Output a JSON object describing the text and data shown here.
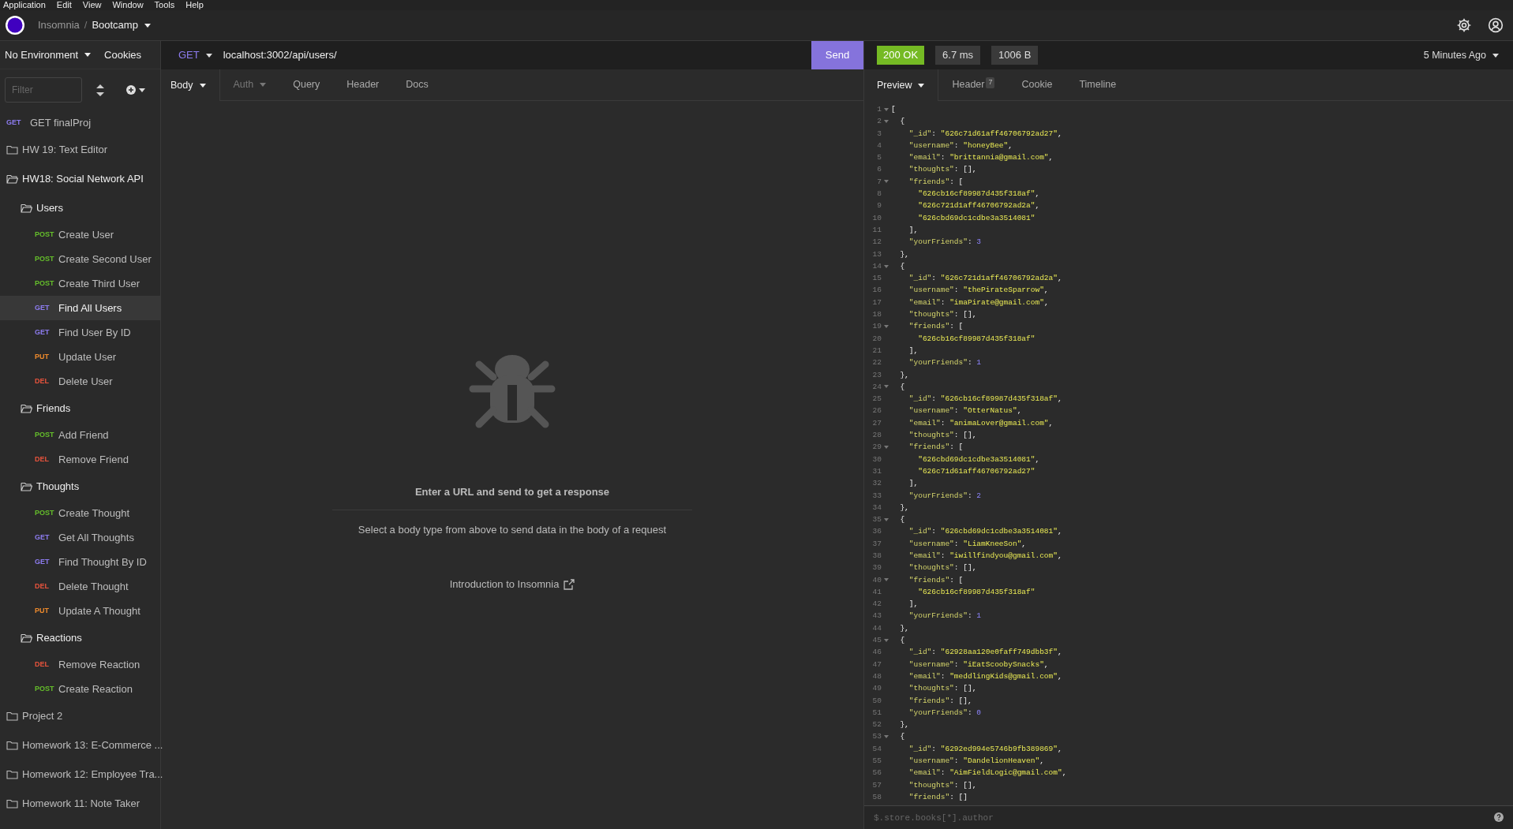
{
  "menu_bar": [
    "Application",
    "Edit",
    "View",
    "Window",
    "Tools",
    "Help"
  ],
  "header": {
    "app": "Insomnia",
    "separator": "/",
    "workspace": "Bootcamp"
  },
  "environment": {
    "label": "No Environment",
    "cookies": "Cookies"
  },
  "filter": {
    "placeholder": "Filter"
  },
  "sidebar": {
    "items": [
      {
        "kind": "request",
        "method": "GET",
        "color": "#8d7cf0",
        "label": "GET finalProj",
        "selected": false
      },
      {
        "kind": "folder",
        "label": "HW 19: Text Editor",
        "expanded": false
      },
      {
        "kind": "folder",
        "label": "HW18: Social Network API",
        "expanded": true,
        "children": [
          {
            "kind": "folder",
            "label": "Users",
            "expanded": true,
            "children": [
              {
                "kind": "request",
                "method": "POST",
                "color": "#65bf2b",
                "label": "Create User",
                "selected": false
              },
              {
                "kind": "request",
                "method": "POST",
                "color": "#65bf2b",
                "label": "Create Second User",
                "selected": false
              },
              {
                "kind": "request",
                "method": "POST",
                "color": "#65bf2b",
                "label": "Create Third User",
                "selected": false
              },
              {
                "kind": "request",
                "method": "GET",
                "color": "#8d7cf0",
                "label": "Find All Users",
                "selected": true
              },
              {
                "kind": "request",
                "method": "GET",
                "color": "#8d7cf0",
                "label": "Find User By ID",
                "selected": false
              },
              {
                "kind": "request",
                "method": "PUT",
                "color": "#ee8a2c",
                "label": "Update User",
                "selected": false
              },
              {
                "kind": "request",
                "method": "DEL",
                "color": "#e8533c",
                "label": "Delete User",
                "selected": false
              }
            ]
          },
          {
            "kind": "folder",
            "label": "Friends",
            "expanded": true,
            "children": [
              {
                "kind": "request",
                "method": "POST",
                "color": "#65bf2b",
                "label": "Add Friend",
                "selected": false
              },
              {
                "kind": "request",
                "method": "DEL",
                "color": "#e8533c",
                "label": "Remove Friend",
                "selected": false
              }
            ]
          },
          {
            "kind": "folder",
            "label": "Thoughts",
            "expanded": true,
            "children": [
              {
                "kind": "request",
                "method": "POST",
                "color": "#65bf2b",
                "label": "Create Thought",
                "selected": false
              },
              {
                "kind": "request",
                "method": "GET",
                "color": "#8d7cf0",
                "label": "Get All Thoughts",
                "selected": false
              },
              {
                "kind": "request",
                "method": "GET",
                "color": "#8d7cf0",
                "label": "Find Thought By ID",
                "selected": false
              },
              {
                "kind": "request",
                "method": "DEL",
                "color": "#e8533c",
                "label": "Delete Thought",
                "selected": false
              },
              {
                "kind": "request",
                "method": "PUT",
                "color": "#ee8a2c",
                "label": "Update A Thought",
                "selected": false
              }
            ]
          },
          {
            "kind": "folder",
            "label": "Reactions",
            "expanded": true,
            "children": [
              {
                "kind": "request",
                "method": "DEL",
                "color": "#e8533c",
                "label": "Remove Reaction",
                "selected": false
              },
              {
                "kind": "request",
                "method": "POST",
                "color": "#65bf2b",
                "label": "Create Reaction",
                "selected": false
              }
            ]
          }
        ]
      },
      {
        "kind": "folder",
        "label": "Project 2",
        "expanded": false
      },
      {
        "kind": "folder",
        "label": "Homework 13: E-Commerce ...",
        "expanded": false
      },
      {
        "kind": "folder",
        "label": "Homework 12: Employee Tra...",
        "expanded": false
      },
      {
        "kind": "folder",
        "label": "Homework 11: Note Taker",
        "expanded": false
      }
    ]
  },
  "request": {
    "method": "GET",
    "url": "localhost:3002/api/users/",
    "send": "Send",
    "tabs": [
      {
        "label": "Body",
        "dropdown": true,
        "selected": true,
        "disabled": false
      },
      {
        "label": "Auth",
        "dropdown": true,
        "selected": false,
        "disabled": true
      },
      {
        "label": "Query",
        "dropdown": false,
        "selected": false,
        "disabled": false
      },
      {
        "label": "Header",
        "dropdown": false,
        "selected": false,
        "disabled": false
      },
      {
        "label": "Docs",
        "dropdown": false,
        "selected": false,
        "disabled": false
      }
    ]
  },
  "empty_state": {
    "title": "Enter a URL and send to get a response",
    "hint": "Select a body type from above to send data in the body of a request",
    "link": "Introduction to Insomnia"
  },
  "response": {
    "status": "200 OK",
    "time": "6.7 ms",
    "size": "1006 B",
    "age": "5 Minutes Ago",
    "tabs": [
      {
        "label": "Preview",
        "dropdown": true,
        "selected": true
      },
      {
        "label": "Header",
        "dropdown": false,
        "badge": "7",
        "selected": false
      },
      {
        "label": "Cookie",
        "dropdown": false,
        "selected": false
      },
      {
        "label": "Timeline",
        "dropdown": false,
        "selected": false
      }
    ],
    "lines": [
      {
        "number": "1",
        "code": "[",
        "foldable": true
      },
      {
        "number": "2",
        "code": "  {",
        "foldable": true
      },
      {
        "number": "3",
        "code": "    \"_id\": \"626c71d61aff46706792ad27\",",
        "foldable": false
      },
      {
        "number": "4",
        "code": "    \"username\": \"honeyBee\",",
        "foldable": false
      },
      {
        "number": "5",
        "code": "    \"email\": \"brittannia@gmail.com\",",
        "foldable": false
      },
      {
        "number": "6",
        "code": "    \"thoughts\": [],",
        "foldable": false
      },
      {
        "number": "7",
        "code": "    \"friends\": [",
        "foldable": true
      },
      {
        "number": "8",
        "code": "      \"626cb16cf89987d435f318af\",",
        "foldable": false
      },
      {
        "number": "9",
        "code": "      \"626c721d1aff46706792ad2a\",",
        "foldable": false
      },
      {
        "number": "10",
        "code": "      \"626cbd69dc1cdbe3a3514081\"",
        "foldable": false
      },
      {
        "number": "11",
        "code": "    ],",
        "foldable": false
      },
      {
        "number": "12",
        "code": "    \"yourFriends\": 3",
        "foldable": false
      },
      {
        "number": "13",
        "code": "  },",
        "foldable": false
      },
      {
        "number": "14",
        "code": "  {",
        "foldable": true
      },
      {
        "number": "15",
        "code": "    \"_id\": \"626c721d1aff46706792ad2a\",",
        "foldable": false
      },
      {
        "number": "16",
        "code": "    \"username\": \"thePirateSparrow\",",
        "foldable": false
      },
      {
        "number": "17",
        "code": "    \"email\": \"imaPirate@gmail.com\",",
        "foldable": false
      },
      {
        "number": "18",
        "code": "    \"thoughts\": [],",
        "foldable": false
      },
      {
        "number": "19",
        "code": "    \"friends\": [",
        "foldable": true
      },
      {
        "number": "20",
        "code": "      \"626cb16cf89987d435f318af\"",
        "foldable": false
      },
      {
        "number": "21",
        "code": "    ],",
        "foldable": false
      },
      {
        "number": "22",
        "code": "    \"yourFriends\": 1",
        "foldable": false
      },
      {
        "number": "23",
        "code": "  },",
        "foldable": false
      },
      {
        "number": "24",
        "code": "  {",
        "foldable": true
      },
      {
        "number": "25",
        "code": "    \"_id\": \"626cb16cf89987d435f318af\",",
        "foldable": false
      },
      {
        "number": "26",
        "code": "    \"username\": \"OtterNatus\",",
        "foldable": false
      },
      {
        "number": "27",
        "code": "    \"email\": \"animaLover@gmail.com\",",
        "foldable": false
      },
      {
        "number": "28",
        "code": "    \"thoughts\": [],",
        "foldable": false
      },
      {
        "number": "29",
        "code": "    \"friends\": [",
        "foldable": true
      },
      {
        "number": "30",
        "code": "      \"626cbd69dc1cdbe3a3514081\",",
        "foldable": false
      },
      {
        "number": "31",
        "code": "      \"626c71d61aff46706792ad27\"",
        "foldable": false
      },
      {
        "number": "32",
        "code": "    ],",
        "foldable": false
      },
      {
        "number": "33",
        "code": "    \"yourFriends\": 2",
        "foldable": false
      },
      {
        "number": "34",
        "code": "  },",
        "foldable": false
      },
      {
        "number": "35",
        "code": "  {",
        "foldable": true
      },
      {
        "number": "36",
        "code": "    \"_id\": \"626cbd69dc1cdbe3a3514081\",",
        "foldable": false
      },
      {
        "number": "37",
        "code": "    \"username\": \"LiamKneeSon\",",
        "foldable": false
      },
      {
        "number": "38",
        "code": "    \"email\": \"iwillfindyou@gmail.com\",",
        "foldable": false
      },
      {
        "number": "39",
        "code": "    \"thoughts\": [],",
        "foldable": false
      },
      {
        "number": "40",
        "code": "    \"friends\": [",
        "foldable": true
      },
      {
        "number": "41",
        "code": "      \"626cb16cf89987d435f318af\"",
        "foldable": false
      },
      {
        "number": "42",
        "code": "    ],",
        "foldable": false
      },
      {
        "number": "43",
        "code": "    \"yourFriends\": 1",
        "foldable": false
      },
      {
        "number": "44",
        "code": "  },",
        "foldable": false
      },
      {
        "number": "45",
        "code": "  {",
        "foldable": true
      },
      {
        "number": "46",
        "code": "    \"_id\": \"62928aa120e0faff749dbb3f\",",
        "foldable": false
      },
      {
        "number": "47",
        "code": "    \"username\": \"iEatScoobySnacks\",",
        "foldable": false
      },
      {
        "number": "48",
        "code": "    \"email\": \"meddlingKids@gmail.com\",",
        "foldable": false
      },
      {
        "number": "49",
        "code": "    \"thoughts\": [],",
        "foldable": false
      },
      {
        "number": "50",
        "code": "    \"friends\": [],",
        "foldable": false
      },
      {
        "number": "51",
        "code": "    \"yourFriends\": 0",
        "foldable": false
      },
      {
        "number": "52",
        "code": "  },",
        "foldable": false
      },
      {
        "number": "53",
        "code": "  {",
        "foldable": true
      },
      {
        "number": "54",
        "code": "    \"_id\": \"6292ed994e5746b9fb389869\",",
        "foldable": false
      },
      {
        "number": "55",
        "code": "    \"username\": \"DandelionHeaven\",",
        "foldable": false
      },
      {
        "number": "56",
        "code": "    \"email\": \"AimFieldLogic@gmail.com\",",
        "foldable": false
      },
      {
        "number": "57",
        "code": "    \"thoughts\": [],",
        "foldable": false
      },
      {
        "number": "58",
        "code": "    \"friends\": []",
        "foldable": false
      }
    ],
    "query_placeholder": "$.store.books[*].author"
  }
}
